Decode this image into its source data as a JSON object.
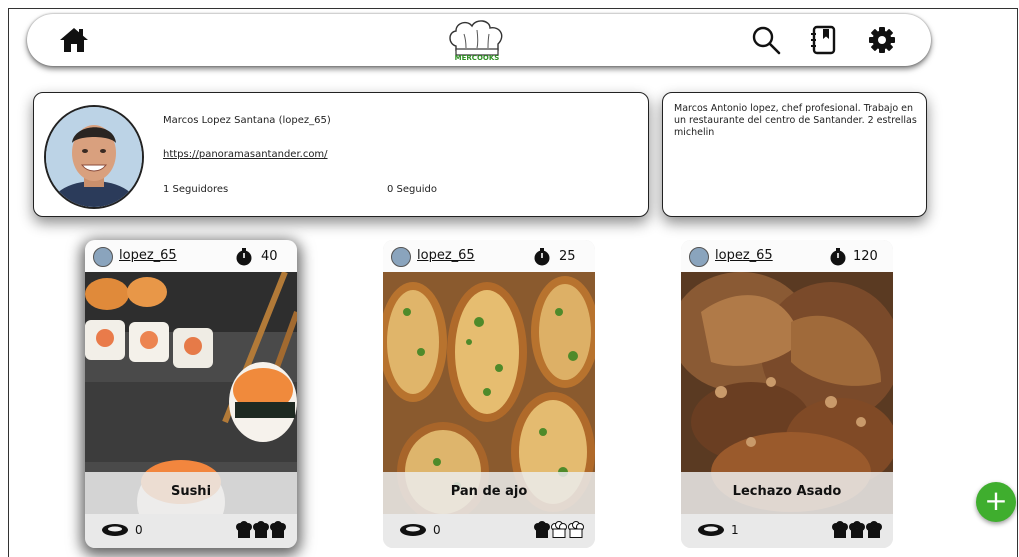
{
  "app": {
    "logo_text": "MERCOOKS",
    "accent_color": "#3fae2e"
  },
  "nav": {
    "home_icon": "home-icon",
    "search_icon": "search-icon",
    "notebook_icon": "notebook-icon",
    "settings_icon": "gear-icon"
  },
  "profile": {
    "name_line": "Marcos Lopez Santana (lopez_65)",
    "website": "https://panoramasantander.com/",
    "followers": "1 Seguidores",
    "following": "0 Seguido",
    "bio": "Marcos Antonio lopez, chef profesional. Trabajo en un restaurante del centro de Santander. 2 estrellas michelin"
  },
  "recipes": [
    {
      "user": "lopez_65",
      "time": "40",
      "title": "Sushi",
      "dishes": "0",
      "difficulty": 3
    },
    {
      "user": "lopez_65",
      "time": "25",
      "title": "Pan de ajo",
      "dishes": "0",
      "difficulty": 1
    },
    {
      "user": "lopez_65",
      "time": "120",
      "title": "Lechazo Asado",
      "dishes": "1",
      "difficulty": 3
    }
  ],
  "fab_label": "+"
}
